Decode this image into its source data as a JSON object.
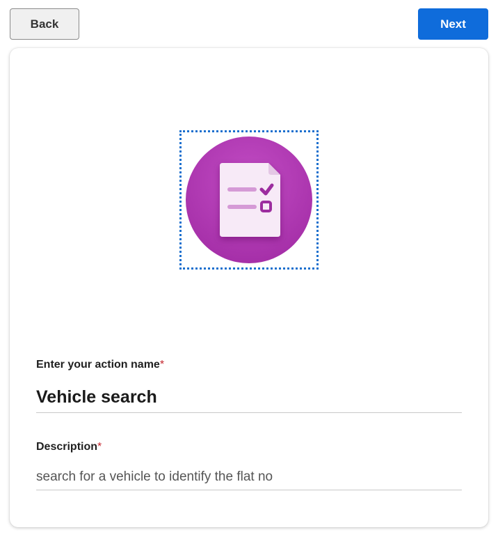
{
  "toolbar": {
    "back_label": "Back",
    "next_label": "Next"
  },
  "action_icon": {
    "name": "forms-checklist-icon",
    "bg_color": "#b03ab3",
    "accent_color": "#9c2d9f"
  },
  "form": {
    "name_label": "Enter your action name",
    "name_required_marker": "*",
    "name_value": "Vehicle search",
    "description_label": "Description",
    "description_required_marker": "*",
    "description_value": "search for a vehicle to identify the flat no"
  },
  "colors": {
    "primary": "#0f6cdb",
    "required": "#c4262e"
  }
}
